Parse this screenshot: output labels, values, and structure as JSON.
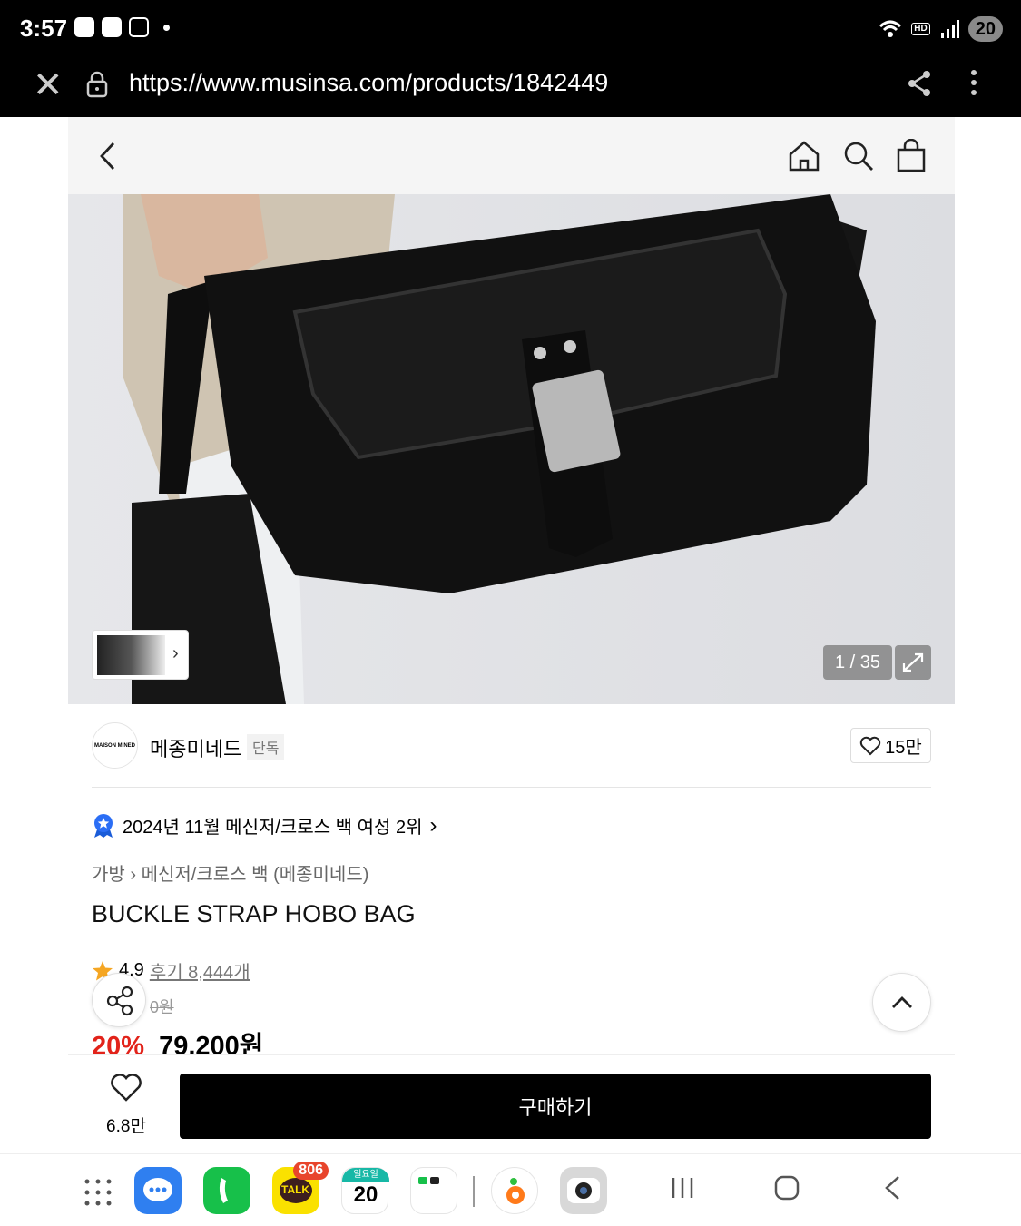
{
  "status_bar": {
    "time": "3:57",
    "hd_label": "HD",
    "battery": "20"
  },
  "browser": {
    "url": "https://www.musinsa.com/products/1842449"
  },
  "gallery": {
    "counter": "1 / 35"
  },
  "brand": {
    "logo_text": "MAISON MINED",
    "name": "메종미네드",
    "tag": "단독",
    "likes": "15만"
  },
  "ranking": {
    "text": "2024년 11월 메신저/크로스 백 여성 2위"
  },
  "breadcrumb": {
    "category": "가방",
    "subcategory": "메신저/크로스 백 (메종미네드)"
  },
  "product": {
    "title": "BUCKLE STRAP HOBO BAG",
    "rating": "4.9",
    "reviews": "후기 8,444개",
    "original_price": "0원",
    "discount": "20%",
    "price": "79,200원"
  },
  "bottom": {
    "wish_count": "6.8만",
    "buy_label": "구매하기"
  },
  "dock": {
    "kakao_badge": "806",
    "calendar_day_label": "일요일",
    "calendar_date": "20",
    "talk_label": "TALK"
  }
}
